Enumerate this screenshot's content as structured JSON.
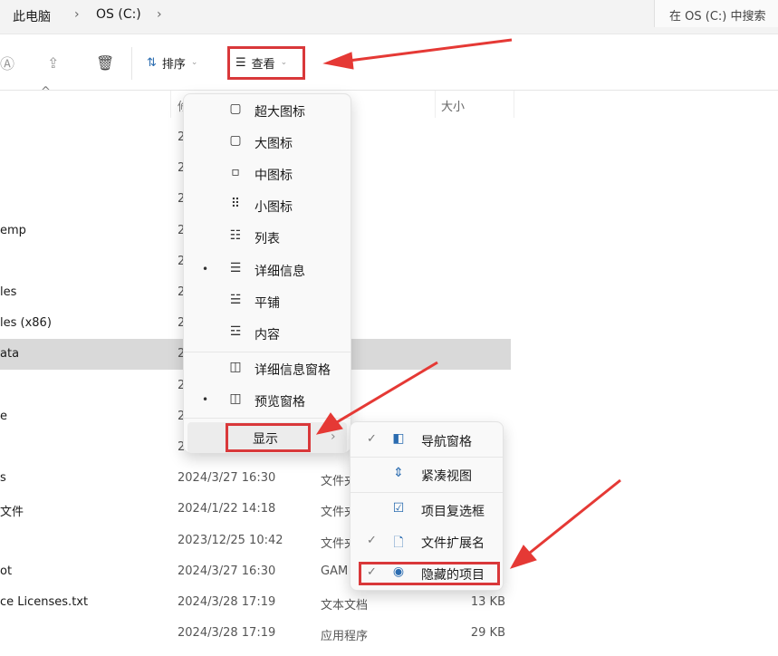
{
  "address": {
    "crumbs": [
      "此电脑",
      "OS (C:)"
    ],
    "separator": "›",
    "search_placeholder": "在 OS (C:) 中搜索"
  },
  "toolbar": {
    "sort_label": "排序",
    "view_label": "查看",
    "more": "···"
  },
  "columns": {
    "date_partial": "修",
    "size": "大小"
  },
  "rows": [
    {
      "name": "",
      "date": "2",
      "type": "",
      "size": ""
    },
    {
      "name": "",
      "date": "2",
      "type": "",
      "size": ""
    },
    {
      "name": "",
      "date": "2",
      "type": "",
      "size": ""
    },
    {
      "name": "emp",
      "date": "2",
      "type": "",
      "size": ""
    },
    {
      "name": "",
      "date": "2",
      "type": "",
      "size": ""
    },
    {
      "name": "les",
      "date": "2",
      "type": "",
      "size": ""
    },
    {
      "name": "les (x86)",
      "date": "2",
      "type": "",
      "size": ""
    },
    {
      "name": "ata",
      "date": "2",
      "type": "",
      "size": ""
    },
    {
      "name": "",
      "date": "2",
      "type": "",
      "size": ""
    },
    {
      "name": "e",
      "date": "2",
      "type": "",
      "size": ""
    },
    {
      "name": "",
      "date": "2",
      "type": "",
      "size": ""
    },
    {
      "name": "s",
      "date": "2024/3/27 16:30",
      "type": "文件夹",
      "size": ""
    },
    {
      "name": "文件",
      "date": "2024/1/22 14:18",
      "type": "文件夹",
      "size": ""
    },
    {
      "name": "",
      "date": "2023/12/25 10:42",
      "type": "文件夹",
      "size": ""
    },
    {
      "name": "ot",
      "date": "2024/3/27 16:30",
      "type": "GAM",
      "size": ""
    },
    {
      "name": "ce Licenses.txt",
      "date": "2024/3/28 17:19",
      "type": "文本文档",
      "size": "13 KB"
    },
    {
      "name": "",
      "date": "2024/3/28 17:19",
      "type": "应用程序",
      "size": "29 KB"
    }
  ],
  "view_menu": {
    "items": [
      {
        "label": "超大图标",
        "icon": "monitor-icon",
        "selected": false
      },
      {
        "label": "大图标",
        "icon": "monitor-icon",
        "selected": false
      },
      {
        "label": "中图标",
        "icon": "monitor-small-icon",
        "selected": false
      },
      {
        "label": "小图标",
        "icon": "grid-icon",
        "selected": false
      },
      {
        "label": "列表",
        "icon": "list-icon",
        "selected": false
      },
      {
        "label": "详细信息",
        "icon": "details-icon",
        "selected": true
      },
      {
        "label": "平铺",
        "icon": "tiles-icon",
        "selected": false
      },
      {
        "label": "内容",
        "icon": "content-icon",
        "selected": false
      },
      {
        "label": "详细信息窗格",
        "icon": "details-pane-icon",
        "selected": false
      },
      {
        "label": "预览窗格",
        "icon": "preview-pane-icon",
        "selected": true
      }
    ],
    "show_label": "显示",
    "selected_marker": "•"
  },
  "show_menu": {
    "items": [
      {
        "label": "导航窗格",
        "icon": "navigation-pane-icon",
        "checked": true
      },
      {
        "label": "紧凑视图",
        "icon": "compact-view-icon",
        "checked": false
      },
      {
        "label": "项目复选框",
        "icon": "checkbox-icon",
        "checked": false
      },
      {
        "label": "文件扩展名",
        "icon": "file-extension-icon",
        "checked": true
      },
      {
        "label": "隐藏的项目",
        "icon": "eye-icon",
        "checked": true
      }
    ],
    "check_mark": "✓"
  },
  "colors": {
    "highlight": "#d9383a",
    "selected_row": "#d9d9d9",
    "accent": "#2b6cb0"
  }
}
